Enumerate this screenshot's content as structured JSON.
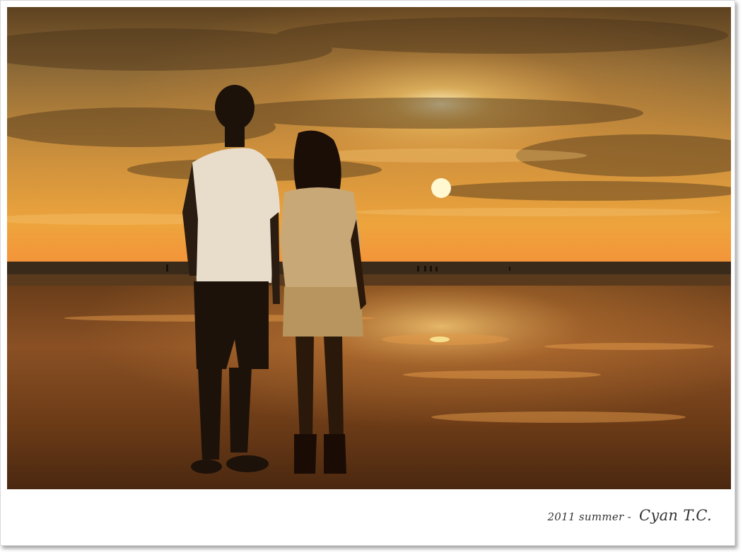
{
  "photo": {
    "subject": "couple silhouette on beach at sunset"
  },
  "caption": {
    "prefix": "2011 summer - ",
    "signature": "Cyan T.C."
  },
  "colors": {
    "sky_top": "#6b4a22",
    "sky_mid": "#c98a36",
    "horizon": "#f0a83a",
    "sun": "#fff3b0",
    "sand_dark": "#3e2510",
    "sand_light": "#a8652a",
    "silhouette": "#1a1008"
  }
}
